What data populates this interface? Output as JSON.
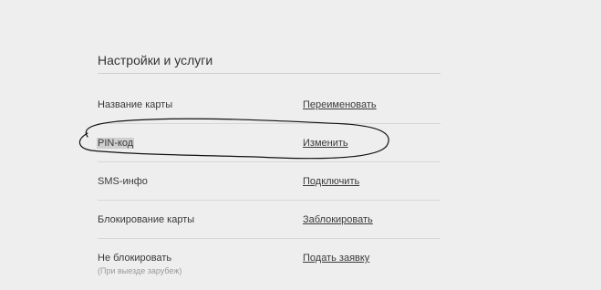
{
  "settings": {
    "title": "Настройки и услуги",
    "rows": [
      {
        "label": "Название карты",
        "action": "Переименовать"
      },
      {
        "label": "PIN-код",
        "action": "Изменить"
      },
      {
        "label": "SMS-инфо",
        "action": "Подключить"
      },
      {
        "label": "Блокирование карты",
        "action": "Заблокировать"
      },
      {
        "label": "Не блокировать",
        "note": "(При выезде зарубеж)",
        "action": "Подать заявку"
      }
    ]
  }
}
